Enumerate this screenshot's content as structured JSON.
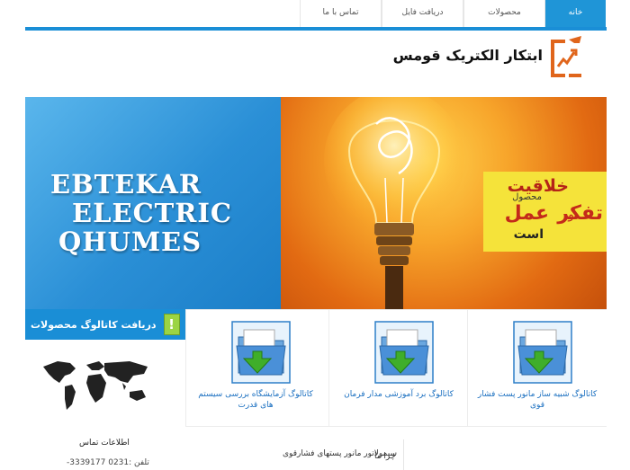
{
  "nav": {
    "tabs": [
      {
        "label": "خانه",
        "active": true
      },
      {
        "label": "محصولات",
        "active": false
      },
      {
        "label": "دریافت فایل",
        "active": false
      },
      {
        "label": "تماس با ما",
        "active": false
      }
    ]
  },
  "header": {
    "site_title": "ابتکار الکتریک قومس"
  },
  "banner": {
    "line1": "EBTEKAR",
    "line2": "ELECTRIC",
    "line3": "QHUMES",
    "slogan": {
      "w1": "خلاقیت",
      "w2": "محصول",
      "w3": "تفکر",
      "w4": "و",
      "w5": "عمل",
      "w6": "است"
    }
  },
  "sidebar": {
    "catalog_button": "دریافت کاتالوگ محصولات",
    "contact_title": "اطلاعات تماس",
    "contact_phone": "تلفن :0231 3339177-"
  },
  "products": [
    {
      "caption": "کاتالوگ شبیه ساز مانور پست فشار قوی"
    },
    {
      "caption": "کاتالوگ برد آموزشی مدار فرمان"
    },
    {
      "caption": "کاتالوگ آزمایشگاه بررسی سیستم های قدرت"
    }
  ],
  "bottom": {
    "left_text": "سیمولاتور مانور پستهای فشارقوی",
    "right_text": "چرا ما"
  },
  "colors": {
    "accent": "#1a8ed6",
    "slogan_bg": "#f5e33a"
  }
}
